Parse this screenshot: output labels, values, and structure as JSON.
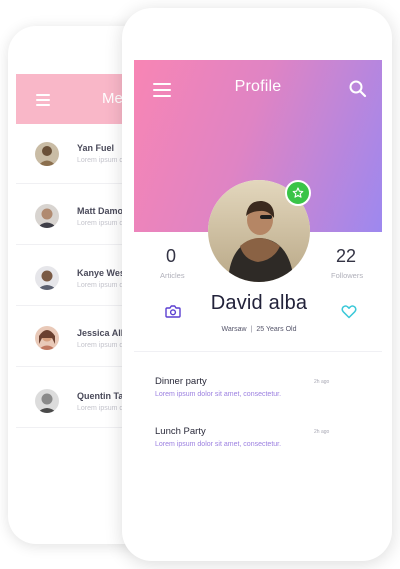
{
  "back_screen": {
    "title": "Me",
    "contacts": [
      {
        "name": "Yan Fuel",
        "preview": "Lorem ipsum dolor sit amet"
      },
      {
        "name": "Matt Damon",
        "preview": "Lorem ipsum dolor sit amet"
      },
      {
        "name": "Kanye West",
        "preview": "Lorem ipsum dolor sit amet"
      },
      {
        "name": "Jessica Alba",
        "preview": "Lorem ipsum dolor sit amet"
      },
      {
        "name": "Quentin Tara",
        "preview": "Lorem ipsum dolor sit amet"
      }
    ]
  },
  "header": {
    "title": "Profile",
    "menu_icon": "hamburger-menu-icon",
    "search_icon": "search-icon"
  },
  "profile": {
    "name": "David alba",
    "location": "Warsaw",
    "age": "25 Years Old",
    "badge_icon": "star-icon"
  },
  "stats": {
    "articles": {
      "value": "0",
      "label": "Articles"
    },
    "followers": {
      "value": "22",
      "label": "Followers"
    }
  },
  "actions": {
    "camera_icon": "camera-icon",
    "heart_icon": "heart-icon"
  },
  "feed": [
    {
      "title": "Dinner party",
      "time": "2h ago",
      "body": "Lorem ipsum dolor sit amet, consectetur."
    },
    {
      "title": "Lunch Party",
      "time": "2h ago",
      "body": "Lorem ipsum dolor sit amet, consectetur."
    }
  ],
  "colors": {
    "gradient_start": "#f885b4",
    "gradient_end": "#9d88ef",
    "badge": "#3ac447",
    "camera": "#5b3fd1",
    "heart": "#3bc8d8",
    "back_header": "#f9b7c8"
  }
}
